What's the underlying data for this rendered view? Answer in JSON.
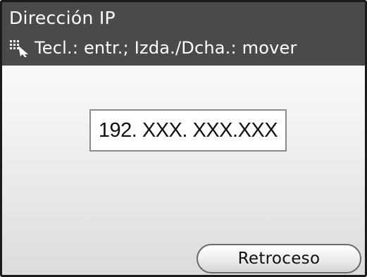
{
  "header": {
    "title": "Dirección IP",
    "hint_icon": "keypad-pointer-icon",
    "hint": "Tecl.: entr.; Izda./Dcha.: mover"
  },
  "ip_field": {
    "value": "192. XXX. XXX.XXX"
  },
  "buttons": {
    "back_label": "Retroceso"
  },
  "colors": {
    "header_bg": "#4a4a4a",
    "header_text": "#ffffff",
    "screen_border": "#1a1a1a"
  }
}
